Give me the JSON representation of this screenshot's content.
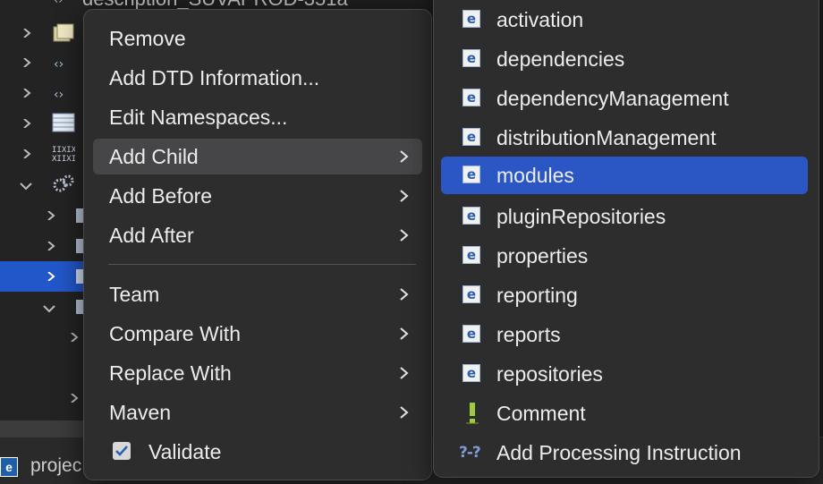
{
  "tree": {
    "top_label": "description_SUVAPROD-351a",
    "bottom_label": "projec"
  },
  "context_menu": {
    "items": [
      {
        "label": "Remove",
        "submenu": false
      },
      {
        "label": "Add DTD Information...",
        "submenu": false
      },
      {
        "label": "Edit Namespaces...",
        "submenu": false
      },
      {
        "label": "Add Child",
        "submenu": true,
        "hovered": true
      },
      {
        "label": "Add Before",
        "submenu": true
      },
      {
        "label": "Add After",
        "submenu": true
      },
      {
        "label": "Team",
        "submenu": true
      },
      {
        "label": "Compare With",
        "submenu": true
      },
      {
        "label": "Replace With",
        "submenu": true
      },
      {
        "label": "Maven",
        "submenu": true
      },
      {
        "label": "Validate",
        "checked": true
      }
    ]
  },
  "submenu": {
    "items": [
      {
        "label": "activation",
        "icon": "element-icon"
      },
      {
        "label": "dependencies",
        "icon": "element-icon"
      },
      {
        "label": "dependencyManagement",
        "icon": "element-icon"
      },
      {
        "label": "distributionManagement",
        "icon": "element-icon"
      },
      {
        "label": "modules",
        "icon": "element-icon",
        "selected": true
      },
      {
        "label": "pluginRepositories",
        "icon": "element-icon"
      },
      {
        "label": "properties",
        "icon": "element-icon"
      },
      {
        "label": "reporting",
        "icon": "element-icon"
      },
      {
        "label": "reports",
        "icon": "element-icon"
      },
      {
        "label": "repositories",
        "icon": "element-icon"
      },
      {
        "label": "Comment",
        "icon": "comment-icon"
      },
      {
        "label": "Add Processing Instruction",
        "icon": "processing-instruction-icon"
      }
    ],
    "element_glyph": "e",
    "pi_glyph": "?-?"
  },
  "colors": {
    "selection": "#2a57c4",
    "tree_selection": "#2257c9",
    "menu_bg": "#2d2d2e",
    "hover_bg": "#464648"
  }
}
